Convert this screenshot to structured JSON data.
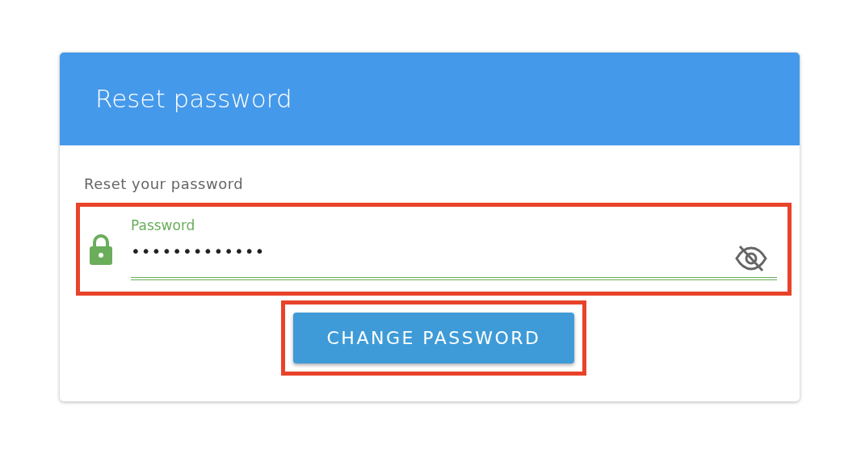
{
  "card": {
    "title": "Reset password",
    "subtitle": "Reset your password"
  },
  "password_field": {
    "label": "Password",
    "value": "•••••••••••••",
    "highlighted": true,
    "focused": true
  },
  "submit_button": {
    "label": "CHANGE PASSWORD",
    "highlighted": true
  }
}
